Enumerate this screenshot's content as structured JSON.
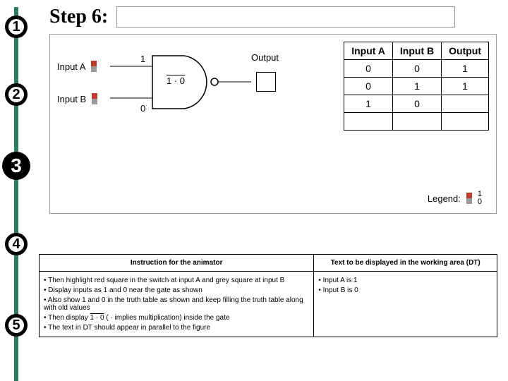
{
  "header": {
    "step_title": "Step 6:"
  },
  "timeline": {
    "steps": [
      "1",
      "2",
      "3",
      "4",
      "5"
    ],
    "current": 3
  },
  "circuit": {
    "input_a_label": "Input A",
    "input_b_label": "Input B",
    "val_a": "1",
    "val_b": "0",
    "gate_expr": "1 · 0",
    "output_label": "Output"
  },
  "truth_table": {
    "headers": [
      "Input A",
      "Input B",
      "Output"
    ],
    "rows": [
      [
        "0",
        "0",
        "1"
      ],
      [
        "0",
        "1",
        "1"
      ],
      [
        "1",
        "0",
        ""
      ],
      [
        "",
        "",
        ""
      ]
    ]
  },
  "legend": {
    "label": "Legend:",
    "v1": "1",
    "v0": "0"
  },
  "instructions": {
    "col1_header": "Instruction for the animator",
    "col2_header": "Text to be displayed in the working area (DT)",
    "col1": [
      "• Then highlight red square in the switch at input A and grey square at input B",
      "• Display inputs as 1 and 0 near the gate as shown",
      "• Also show 1 and 0 in the truth table as shown and keep filling the truth table along with old values",
      "• Then display 1 · 0 ( · implies multiplication) inside the gate",
      "• The text in DT should appear in parallel to the figure"
    ],
    "col2": [
      "• Input A is 1",
      "• Input B is 0"
    ]
  },
  "chart_data": {
    "type": "table",
    "title": "NAND truth table (partial, Step 6)",
    "columns": [
      "Input A",
      "Input B",
      "Output"
    ],
    "rows": [
      {
        "Input A": 0,
        "Input B": 0,
        "Output": 1
      },
      {
        "Input A": 0,
        "Input B": 1,
        "Output": 1
      },
      {
        "Input A": 1,
        "Input B": 0,
        "Output": null
      },
      {
        "Input A": null,
        "Input B": null,
        "Output": null
      }
    ],
    "gate_type": "NAND",
    "current_inputs": {
      "A": 1,
      "B": 0
    },
    "gate_internal_expression": "overline(1 · 0)"
  }
}
